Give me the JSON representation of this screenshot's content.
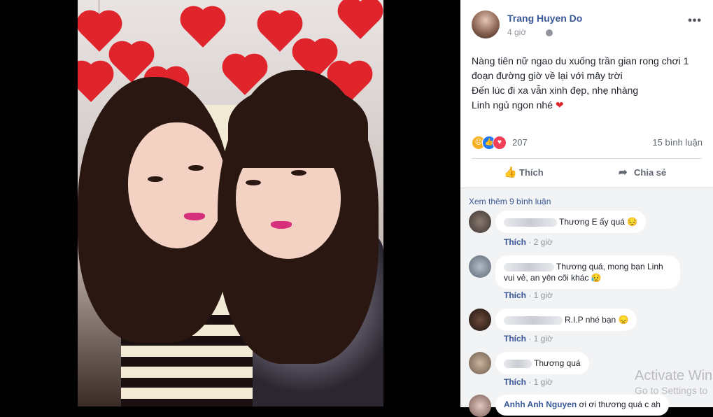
{
  "post": {
    "author": "Trang Huyen Do",
    "time": "4 giờ",
    "text_lines": [
      "Nàng tiên nữ ngao du xuống trần gian rong chơi 1",
      "đoạn đường giờ về lại với mây trời",
      "Đến lúc đi xa vẫn xinh đẹp, nhẹ nhàng",
      "Linh ngủ ngon nhé"
    ],
    "reaction_count": "207",
    "comment_count": "15 bình luận",
    "like_label": "Thích",
    "share_label": "Chia sẻ",
    "more_icon": "•••"
  },
  "comments_section": {
    "more_label": "Xem thêm 9 bình luận",
    "items": [
      {
        "text": "Thương E ấy quá 😔",
        "like": "Thích",
        "time": "2 giờ"
      },
      {
        "text_line1": "Thương quá, mong bạn Linh",
        "text_line2": "vui vẻ, an yên cõi khác 😥",
        "like": "Thích",
        "time": "1 giờ"
      },
      {
        "text": "R.I.P nhé bạn 😞",
        "like": "Thích",
        "time": "1 giờ"
      },
      {
        "text": "Thương quá",
        "like": "Thích",
        "time": "1 giờ"
      },
      {
        "name": "Anhh Anh Nguyen",
        "text": "ơi ơi thương quá c ah"
      }
    ]
  },
  "watermark": {
    "title": "Activate Win",
    "subtitle": "Go to Settings to"
  },
  "colors": {
    "link": "#385898",
    "heart": "#e0242c"
  }
}
